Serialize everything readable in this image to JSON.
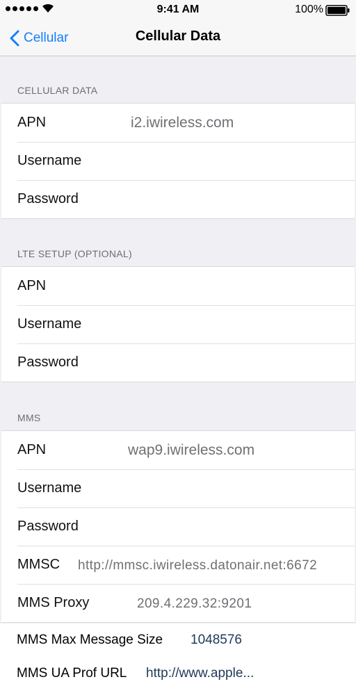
{
  "status_bar": {
    "time": "9:41 AM",
    "battery": "100%"
  },
  "nav": {
    "back_label": "Cellular",
    "title": "Cellular Data",
    "accent_color": "#157efb"
  },
  "sections": [
    {
      "header": "CELLULAR DATA",
      "rows": [
        {
          "label": "APN",
          "value": "i2.iwireless.com"
        },
        {
          "label": "Username",
          "value": ""
        },
        {
          "label": "Password",
          "value": ""
        }
      ]
    },
    {
      "header": "LTE SETUP (OPTIONAL)",
      "rows": [
        {
          "label": "APN",
          "value": ""
        },
        {
          "label": "Username",
          "value": ""
        },
        {
          "label": "Password",
          "value": ""
        }
      ]
    },
    {
      "header": "MMS",
      "rows": [
        {
          "label": "APN",
          "value": "wap9.iwireless.com"
        },
        {
          "label": "Username",
          "value": ""
        },
        {
          "label": "Password",
          "value": ""
        },
        {
          "label": "MMSC",
          "value": "http://mmsc.iwireless.datonair.net:6672"
        },
        {
          "label": "MMS Proxy",
          "value": "209.4.229.32:9201"
        },
        {
          "label": "MMS Max Message Size",
          "value": "1048576"
        },
        {
          "label": "MMS UA Prof URL",
          "value": "http://www.apple..."
        }
      ]
    }
  ]
}
